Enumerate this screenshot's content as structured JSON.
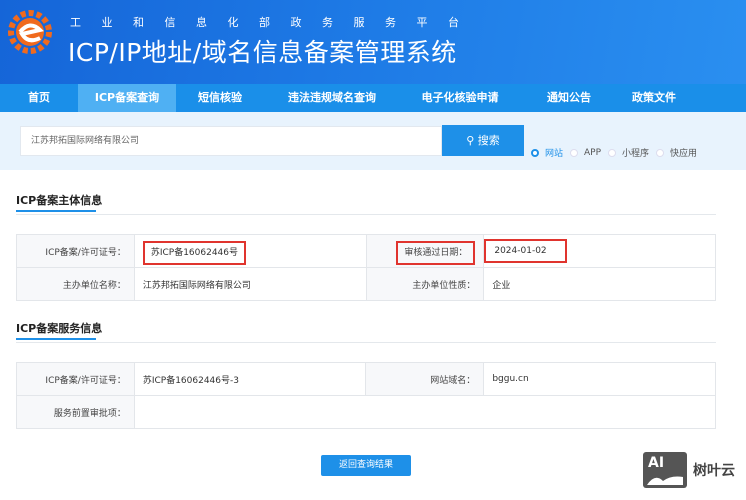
{
  "header": {
    "subtitle": "工业和信息化部政务服务平台",
    "title": "ICP/IP地址/域名信息备案管理系统"
  },
  "nav": [
    {
      "label": "首页"
    },
    {
      "label": "ICP备案查询",
      "active": true
    },
    {
      "label": "短信核验"
    },
    {
      "label": "违法违规域名查询"
    },
    {
      "label": "电子化核验申请"
    },
    {
      "label": "通知公告"
    },
    {
      "label": "政策文件"
    }
  ],
  "search": {
    "value": "江苏邦拓国际网络有限公司",
    "button": "搜索",
    "options": [
      "网站",
      "APP",
      "小程序",
      "快应用"
    ],
    "selected": "网站"
  },
  "subject": {
    "title": "ICP备案主体信息",
    "rows": [
      {
        "l1": "ICP备案/许可证号：",
        "v1": "苏ICP备16062446号",
        "l2": "审核通过日期：",
        "v2": "2024-01-02"
      },
      {
        "l1": "主办单位名称：",
        "v1": "江苏邦拓国际网络有限公司",
        "l2": "主办单位性质：",
        "v2": "企业"
      }
    ]
  },
  "service": {
    "title": "ICP备案服务信息",
    "rows": [
      {
        "l1": "ICP备案/许可证号：",
        "v1": "苏ICP备16062446号-3",
        "l2": "网站域名：",
        "v2": "bggu.cn"
      },
      {
        "l1": "服务前置审批项：",
        "v1": ""
      }
    ]
  },
  "back_button": "返回查询结果",
  "watermark": {
    "badge": "AI",
    "text": "树叶云"
  },
  "colors": {
    "accent": "#1e90e8",
    "highlight": "#e0342e"
  }
}
